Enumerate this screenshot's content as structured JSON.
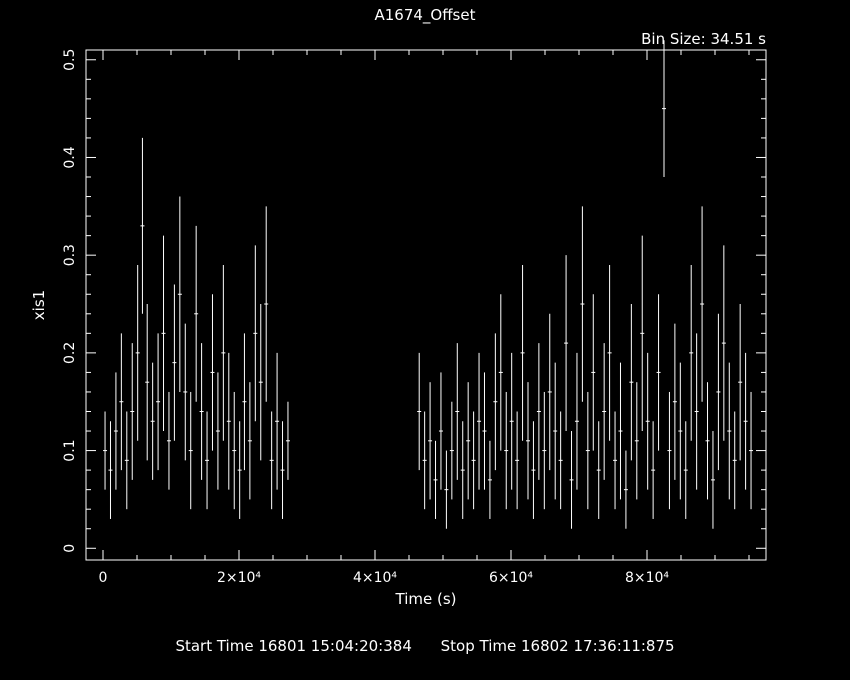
{
  "title": "A1674_Offset",
  "bin_size": "Bin Size: 34.51 s",
  "footer": {
    "start": "Start Time 16801 15:04:20:384",
    "stop": "Stop Time 16802 17:36:11:875"
  },
  "colors": {
    "background": "#000000",
    "foreground": "#ffffff"
  },
  "chart_data": {
    "type": "scatter",
    "title": "A1674_Offset",
    "xlabel": "Time (s)",
    "ylabel": "xis1",
    "xlim": [
      -2500,
      97500
    ],
    "ylim": [
      -0.012,
      0.51
    ],
    "xticks": [
      {
        "v": 0,
        "label": "0"
      },
      {
        "v": 20000,
        "label": "2×10⁴"
      },
      {
        "v": 40000,
        "label": "4×10⁴"
      },
      {
        "v": 60000,
        "label": "6×10⁴"
      },
      {
        "v": 80000,
        "label": "8×10⁴"
      }
    ],
    "yticks": [
      {
        "v": 0,
        "label": "0"
      },
      {
        "v": 0.1,
        "label": "0.1"
      },
      {
        "v": 0.2,
        "label": "0.2"
      },
      {
        "v": 0.3,
        "label": "0.3"
      },
      {
        "v": 0.4,
        "label": "0.4"
      },
      {
        "v": 0.5,
        "label": "0.5"
      }
    ],
    "series": [
      {
        "x": [
          300,
          1100,
          1900,
          2700,
          3500,
          4300,
          5100,
          5800,
          6500,
          7300,
          8100,
          8900,
          9700,
          10500,
          11300,
          12100,
          12900,
          13700,
          14500,
          15300,
          16100,
          16900,
          17700,
          18500,
          19300,
          20100,
          20800,
          21600,
          22400,
          23200,
          24000,
          24800,
          25600,
          26400,
          27200,
          46500,
          47300,
          48100,
          48900,
          49700,
          50500,
          51300,
          52100,
          52900,
          53700,
          54500,
          55300,
          56100,
          56900,
          57700,
          58500,
          59300,
          60100,
          60900,
          61700,
          62500,
          63300,
          64100,
          64900,
          65700,
          66500,
          67300,
          68100,
          68900,
          69700,
          70500,
          71300,
          72100,
          72900,
          73700,
          74500,
          75300,
          76100,
          76900,
          77700,
          78500,
          79300,
          80100,
          80900,
          81700,
          82500,
          83300,
          84100,
          84900,
          85700,
          86500,
          87300,
          88100,
          88900,
          89700,
          90500,
          91300,
          92100,
          92900,
          93700,
          94500,
          95300
        ],
        "y": [
          0.1,
          0.08,
          0.12,
          0.15,
          0.09,
          0.14,
          0.2,
          0.33,
          0.17,
          0.13,
          0.15,
          0.22,
          0.11,
          0.19,
          0.26,
          0.16,
          0.1,
          0.24,
          0.14,
          0.09,
          0.18,
          0.12,
          0.2,
          0.13,
          0.1,
          0.08,
          0.15,
          0.11,
          0.22,
          0.17,
          0.25,
          0.09,
          0.13,
          0.08,
          0.11,
          0.14,
          0.09,
          0.11,
          0.07,
          0.12,
          0.06,
          0.1,
          0.14,
          0.08,
          0.11,
          0.09,
          0.13,
          0.12,
          0.07,
          0.15,
          0.18,
          0.1,
          0.13,
          0.09,
          0.2,
          0.11,
          0.08,
          0.14,
          0.1,
          0.16,
          0.12,
          0.09,
          0.21,
          0.07,
          0.13,
          0.25,
          0.1,
          0.18,
          0.08,
          0.14,
          0.2,
          0.09,
          0.12,
          0.06,
          0.17,
          0.11,
          0.22,
          0.13,
          0.08,
          0.18,
          0.45,
          0.1,
          0.15,
          0.12,
          0.08,
          0.2,
          0.14,
          0.25,
          0.11,
          0.07,
          0.16,
          0.21,
          0.12,
          0.09,
          0.17,
          0.13,
          0.1
        ],
        "err": [
          0.04,
          0.05,
          0.06,
          0.07,
          0.05,
          0.07,
          0.09,
          0.09,
          0.08,
          0.06,
          0.07,
          0.1,
          0.05,
          0.08,
          0.1,
          0.07,
          0.06,
          0.09,
          0.07,
          0.05,
          0.08,
          0.06,
          0.09,
          0.07,
          0.06,
          0.05,
          0.07,
          0.06,
          0.09,
          0.08,
          0.1,
          0.05,
          0.07,
          0.05,
          0.04,
          0.06,
          0.05,
          0.06,
          0.04,
          0.06,
          0.04,
          0.05,
          0.07,
          0.05,
          0.06,
          0.05,
          0.07,
          0.06,
          0.04,
          0.07,
          0.08,
          0.06,
          0.07,
          0.05,
          0.09,
          0.06,
          0.05,
          0.07,
          0.06,
          0.08,
          0.07,
          0.05,
          0.09,
          0.05,
          0.07,
          0.1,
          0.06,
          0.08,
          0.05,
          0.07,
          0.09,
          0.05,
          0.07,
          0.04,
          0.08,
          0.06,
          0.1,
          0.07,
          0.05,
          0.08,
          0.07,
          0.06,
          0.08,
          0.07,
          0.05,
          0.09,
          0.08,
          0.1,
          0.06,
          0.05,
          0.08,
          0.1,
          0.07,
          0.05,
          0.08,
          0.07,
          0.06
        ]
      }
    ]
  }
}
